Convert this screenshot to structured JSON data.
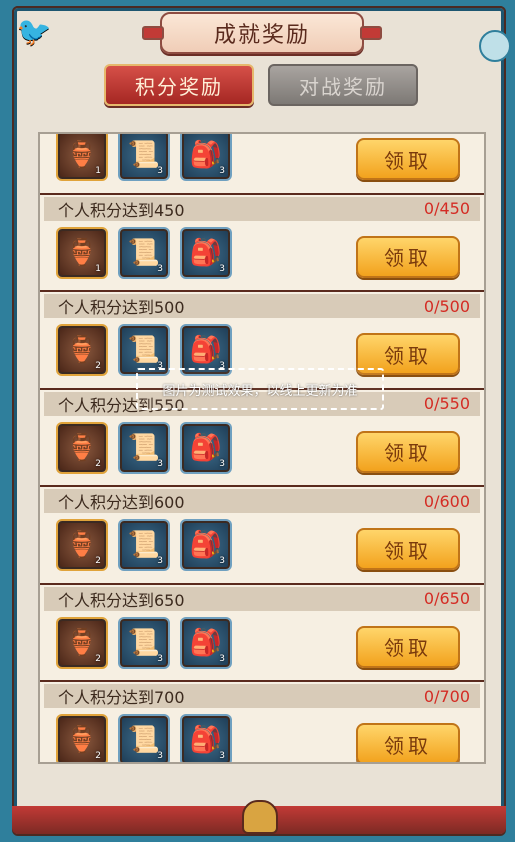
{
  "title": "成就奖励",
  "tabs": [
    {
      "label": "积分奖励",
      "active": true
    },
    {
      "label": "对战奖励",
      "active": false
    }
  ],
  "items": [
    {
      "condition": "",
      "progress": "",
      "rewards": [
        {
          "icon": "jar-icon",
          "count": "1"
        },
        {
          "icon": "scroll-icon",
          "count": "3"
        },
        {
          "icon": "bag-icon",
          "count": "3"
        }
      ],
      "button": "领取"
    },
    {
      "condition": "个人积分达到450",
      "progress": "0/450",
      "rewards": [
        {
          "icon": "jar-icon",
          "count": "1"
        },
        {
          "icon": "scroll-icon",
          "count": "3"
        },
        {
          "icon": "bag-icon",
          "count": "3"
        }
      ],
      "button": "领取"
    },
    {
      "condition": "个人积分达到500",
      "progress": "0/500",
      "rewards": [
        {
          "icon": "jar-icon",
          "count": "2"
        },
        {
          "icon": "scroll-icon",
          "count": "3"
        },
        {
          "icon": "bag-icon",
          "count": "3"
        }
      ],
      "button": "领取"
    },
    {
      "condition": "个人积分达到550",
      "progress": "0/550",
      "rewards": [
        {
          "icon": "jar-icon",
          "count": "2"
        },
        {
          "icon": "scroll-icon",
          "count": "3"
        },
        {
          "icon": "bag-icon",
          "count": "3"
        }
      ],
      "button": "领取"
    },
    {
      "condition": "个人积分达到600",
      "progress": "0/600",
      "rewards": [
        {
          "icon": "jar-icon",
          "count": "2"
        },
        {
          "icon": "scroll-icon",
          "count": "3"
        },
        {
          "icon": "bag-icon",
          "count": "3"
        }
      ],
      "button": "领取"
    },
    {
      "condition": "个人积分达到650",
      "progress": "0/650",
      "rewards": [
        {
          "icon": "jar-icon",
          "count": "2"
        },
        {
          "icon": "scroll-icon",
          "count": "3"
        },
        {
          "icon": "bag-icon",
          "count": "3"
        }
      ],
      "button": "领取"
    },
    {
      "condition": "个人积分达到700",
      "progress": "0/700",
      "rewards": [
        {
          "icon": "jar-icon",
          "count": "2"
        },
        {
          "icon": "scroll-icon",
          "count": "3"
        },
        {
          "icon": "bag-icon",
          "count": "3"
        }
      ],
      "button": "领取"
    }
  ],
  "watermark": "图片为测试效果，以线上更新为准",
  "colors": {
    "accent_red": "#c23a36",
    "progress_red": "#d42c24",
    "claim_gold": "#f2a21d",
    "teal": "#2f7f9c"
  }
}
